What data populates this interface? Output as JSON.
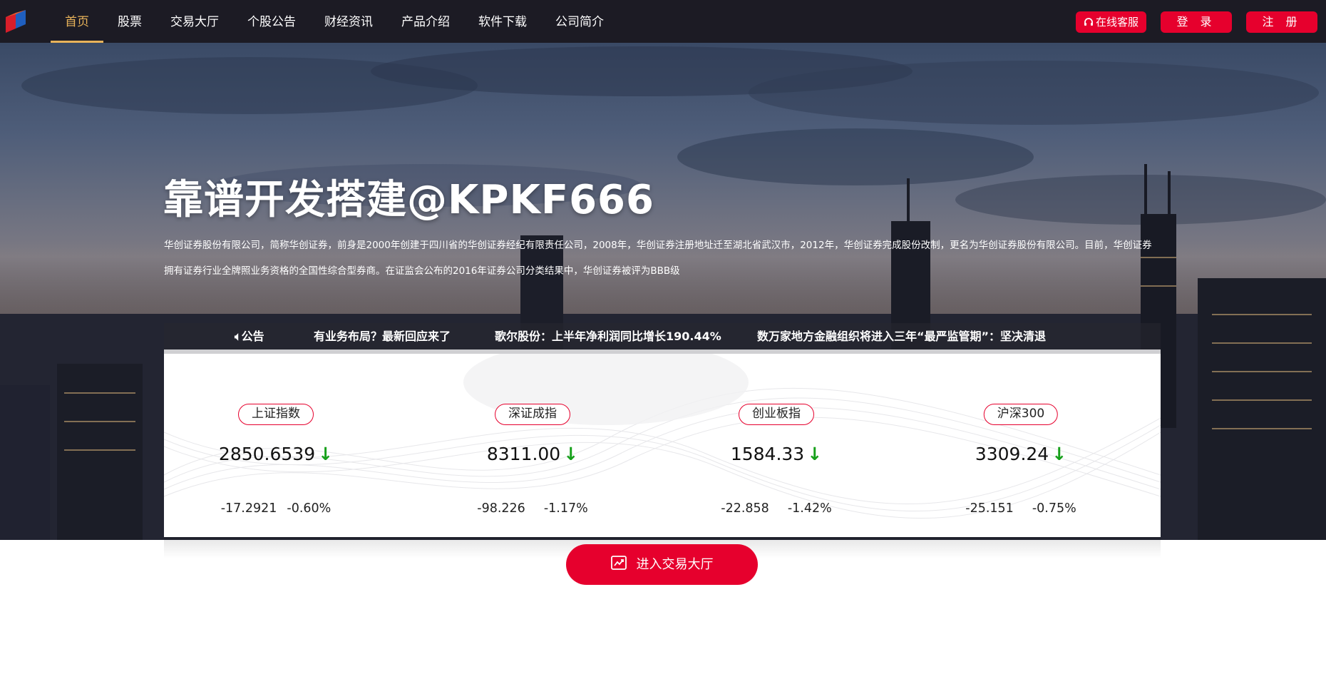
{
  "nav": {
    "items": [
      {
        "label": "首页",
        "active": true
      },
      {
        "label": "股票"
      },
      {
        "label": "交易大厅"
      },
      {
        "label": "个股公告"
      },
      {
        "label": "财经资讯"
      },
      {
        "label": "产品介绍"
      },
      {
        "label": "软件下载"
      },
      {
        "label": "公司简介"
      }
    ],
    "service_label": "在线客服",
    "login_label": "登 录",
    "register_label": "注 册"
  },
  "hero": {
    "title": "靠谱开发搭建@KPKF666",
    "description": "华创证券股份有限公司，简称华创证券，前身是2000年创建于四川省的华创证券经纪有限责任公司，2008年，华创证券注册地址迁至湖北省武汉市，2012年，华创证券完成股份改制，更名为华创证券股份有限公司。目前，华创证券拥有证券行业全牌照业务资格的全国性综合型券商。在证监会公布的2016年证券公司分类结果中，华创证券被评为BBB级"
  },
  "ticker": {
    "label": "公告",
    "items": [
      "有业务布局？最新回应来了",
      "歌尔股份：上半年净利润同比增长190.44%",
      "数万家地方金融组织将进入三年“最严监管期”：坚决清退"
    ]
  },
  "indices": [
    {
      "name": "上证指数",
      "price": "2850.6539",
      "arrow": "↓",
      "change": "-17.2921",
      "percent": "-0.60%"
    },
    {
      "name": "深证成指",
      "price": "8311.00",
      "arrow": "↓",
      "change": "-98.226",
      "percent": "-1.17%"
    },
    {
      "name": "创业板指",
      "price": "1584.33",
      "arrow": "↓",
      "change": "-22.858",
      "percent": "-1.42%"
    },
    {
      "name": "沪深300",
      "price": "3309.24",
      "arrow": "↓",
      "change": "-25.151",
      "percent": "-0.75%"
    }
  ],
  "cta": {
    "label": "进入交易大厅"
  },
  "colors": {
    "accent": "#e6002d",
    "nav_bg": "#1c1b24",
    "active_nav": "#e8b35a",
    "down": "#16a01a"
  }
}
